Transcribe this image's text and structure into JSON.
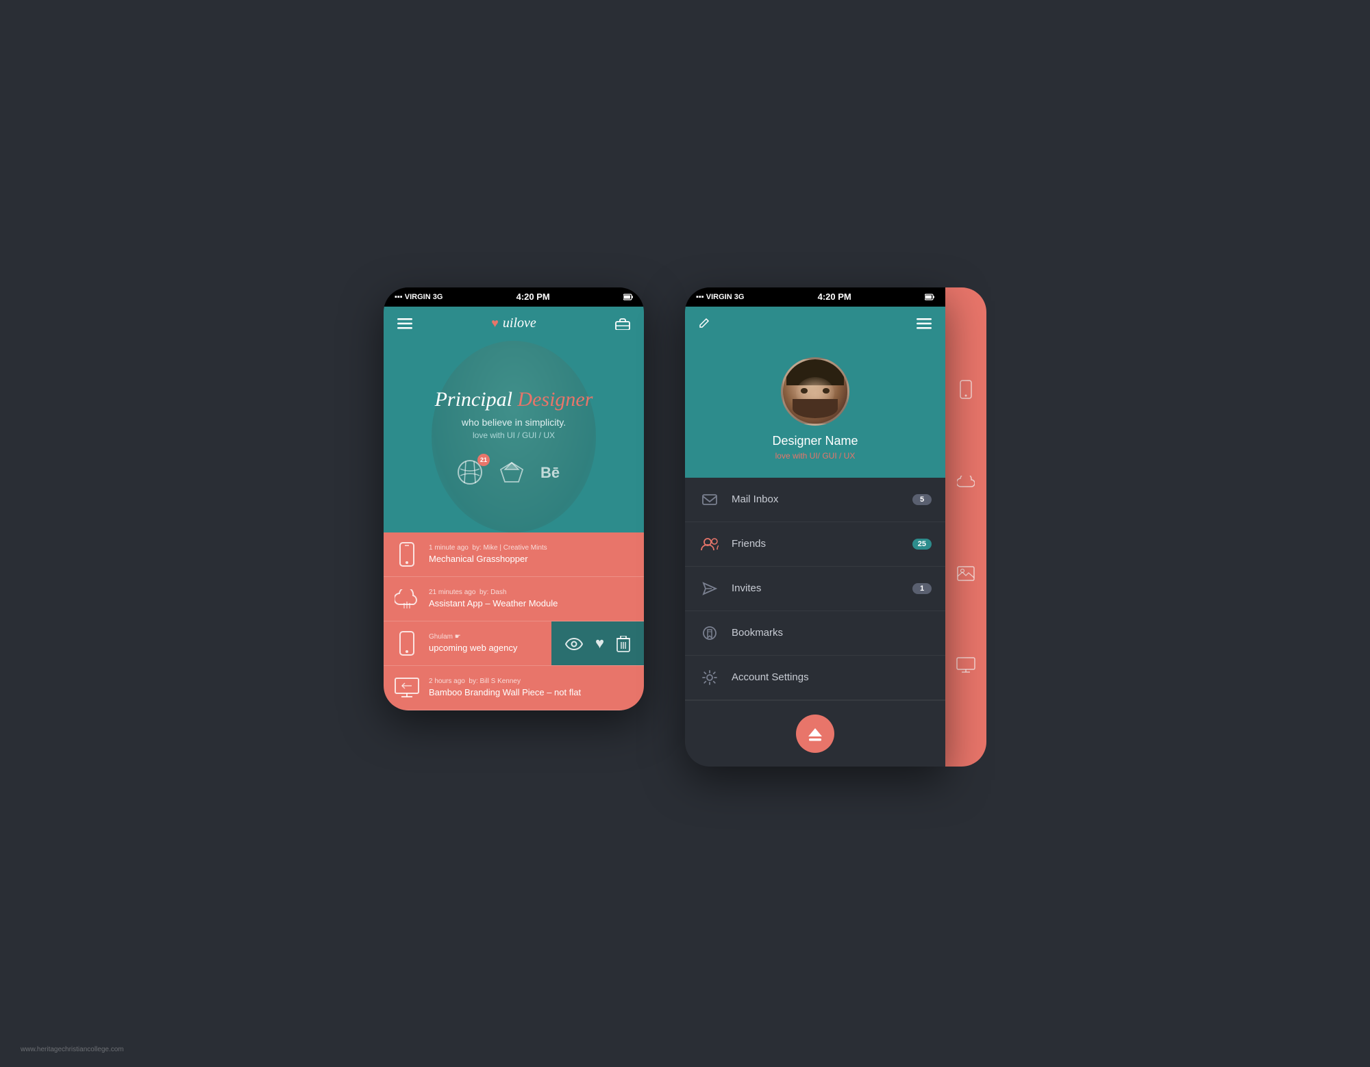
{
  "page": {
    "background": "#2a2e35",
    "watermark": "www.heritagechristiancollege.com"
  },
  "phone1": {
    "status_bar": {
      "signal": "▪▪▪ VIRGIN  3G",
      "time": "4:20 PM",
      "icons": "⏰ 🔋"
    },
    "header": {
      "logo": "uilove",
      "menu_icon": "☰",
      "briefcase_icon": "💼"
    },
    "hero": {
      "title_part1": "Principal ",
      "title_part2": "Designer",
      "subtitle": "who believe in simplicity.",
      "tagline": "love with UI / GUI / UX",
      "dribbble_badge": "21"
    },
    "feed": {
      "items": [
        {
          "icon": "phone",
          "time_ago": "1 minute ago",
          "by": "by: Mike | Creative Mints",
          "title": "Mechanical Grasshopper"
        },
        {
          "icon": "cloud",
          "time_ago": "21 minutes ago",
          "by": "by: Dash",
          "title": "Assistant App – Weather Module"
        },
        {
          "icon": "phone",
          "time_ago": "Ghulam ☛",
          "by": "",
          "title": "upcoming web agency",
          "swipe_active": true
        },
        {
          "icon": "monitor",
          "time_ago": "2 hours ago",
          "by": "by: Bill S Kenney",
          "title": "Bamboo Branding  Wall Piece – not flat"
        }
      ]
    }
  },
  "phone2": {
    "status_bar": {
      "signal": "▪▪▪ VIRGIN  3G",
      "time": "4:20 PM",
      "icons": "⏰ 🔋"
    },
    "header": {
      "pencil_icon": "✏",
      "menu_icon": "☰"
    },
    "profile": {
      "name": "Designer Name",
      "tagline": "love with UI/ GUI / UX"
    },
    "menu": {
      "items": [
        {
          "key": "mail",
          "icon": "envelope",
          "label": "Mail Inbox",
          "badge": "5",
          "badge_type": "gray"
        },
        {
          "key": "friends",
          "icon": "users",
          "label": "Friends",
          "badge": "25",
          "badge_type": "teal"
        },
        {
          "key": "invites",
          "icon": "send",
          "label": "Invites",
          "badge": "1",
          "badge_type": "gray"
        },
        {
          "key": "bookmarks",
          "icon": "bookmark",
          "label": "Bookmarks",
          "badge": "",
          "badge_type": ""
        },
        {
          "key": "settings",
          "icon": "gear",
          "label": "Account Settings",
          "badge": "",
          "badge_type": ""
        }
      ]
    },
    "eject_button": "⏏",
    "side_strip_icons": [
      "phone",
      "cloud",
      "image",
      "monitor"
    ]
  }
}
